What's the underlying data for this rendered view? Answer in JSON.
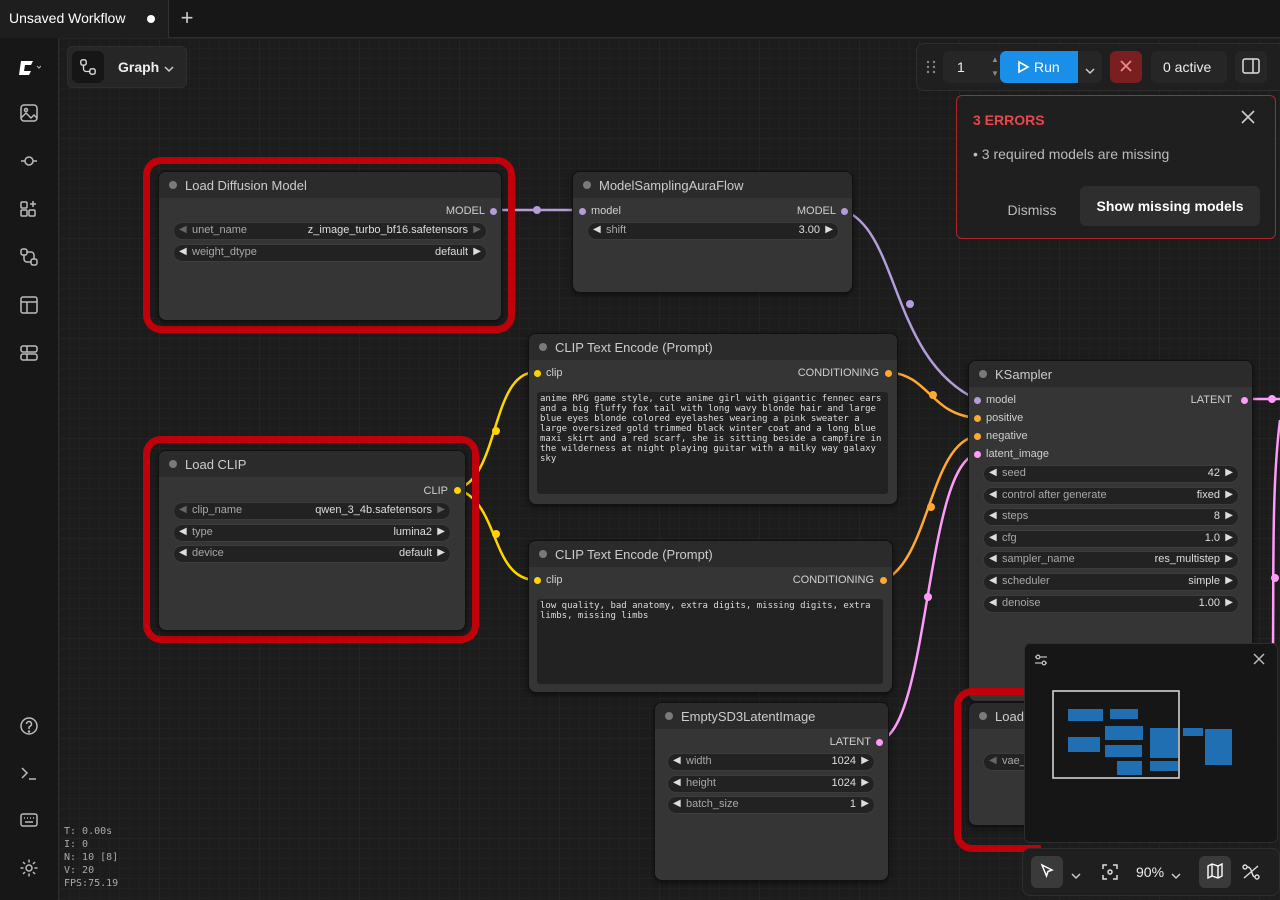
{
  "tab": {
    "title": "Unsaved Workflow"
  },
  "graph_selector": {
    "label": "Graph"
  },
  "toolbar": {
    "queue_count": "1",
    "run_label": "Run",
    "active_label": "0 active"
  },
  "errors": {
    "title": "3 ERRORS",
    "message": "3 required models are missing",
    "dismiss": "Dismiss",
    "show_missing": "Show missing models"
  },
  "nodes": {
    "load_diffusion": {
      "title": "Load Diffusion Model",
      "output": "MODEL",
      "widgets": [
        {
          "name": "unet_name",
          "value": "z_image_turbo_bf16.safetensors"
        },
        {
          "name": "weight_dtype",
          "value": "default"
        }
      ]
    },
    "model_sampling": {
      "title": "ModelSamplingAuraFlow",
      "input": "model",
      "output": "MODEL",
      "widgets": [
        {
          "name": "shift",
          "value": "3.00"
        }
      ]
    },
    "clip_pos": {
      "title": "CLIP Text Encode (Prompt)",
      "input": "clip",
      "output": "CONDITIONING",
      "text": "anime RPG game style, cute anime girl with gigantic fennec ears and a big fluffy fox tail with long wavy blonde hair and large blue eyes blonde colored eyelashes wearing a pink sweater a large oversized gold trimmed black winter coat and a long blue maxi skirt and a red scarf, she is sitting beside a campfire in the wilderness at night playing guitar with a milky way galaxy sky"
    },
    "clip_neg": {
      "title": "CLIP Text Encode (Prompt)",
      "input": "clip",
      "output": "CONDITIONING",
      "text": "low quality, bad anatomy, extra digits, missing digits, extra limbs, missing limbs"
    },
    "load_clip": {
      "title": "Load CLIP",
      "output": "CLIP",
      "widgets": [
        {
          "name": "clip_name",
          "value": "qwen_3_4b.safetensors"
        },
        {
          "name": "type",
          "value": "lumina2"
        },
        {
          "name": "device",
          "value": "default"
        }
      ]
    },
    "ksampler": {
      "title": "KSampler",
      "inputs": [
        "model",
        "positive",
        "negative",
        "latent_image"
      ],
      "output": "LATENT",
      "widgets": [
        {
          "name": "seed",
          "value": "42"
        },
        {
          "name": "control after generate",
          "value": "fixed"
        },
        {
          "name": "steps",
          "value": "8"
        },
        {
          "name": "cfg",
          "value": "1.0"
        },
        {
          "name": "sampler_name",
          "value": "res_multistep"
        },
        {
          "name": "scheduler",
          "value": "simple"
        },
        {
          "name": "denoise",
          "value": "1.00"
        }
      ]
    },
    "empty_latent": {
      "title": "EmptySD3LatentImage",
      "output": "LATENT",
      "widgets": [
        {
          "name": "width",
          "value": "1024"
        },
        {
          "name": "height",
          "value": "1024"
        },
        {
          "name": "batch_size",
          "value": "1"
        }
      ]
    },
    "load_vae": {
      "title": "Load",
      "widget_name": "vae_"
    }
  },
  "stats": {
    "t": "T: 0.00s",
    "i": "I: 0",
    "n": "N: 10 [8]",
    "v": "V: 20",
    "fps": "FPS:75.19"
  },
  "zoom": {
    "level": "90%"
  },
  "colors": {
    "model": "#b39ddb",
    "clip": "#ffd500",
    "conditioning": "#ffa931",
    "latent": "#ff9cf9",
    "run": "#1a8fea",
    "error": "#c0000a"
  }
}
